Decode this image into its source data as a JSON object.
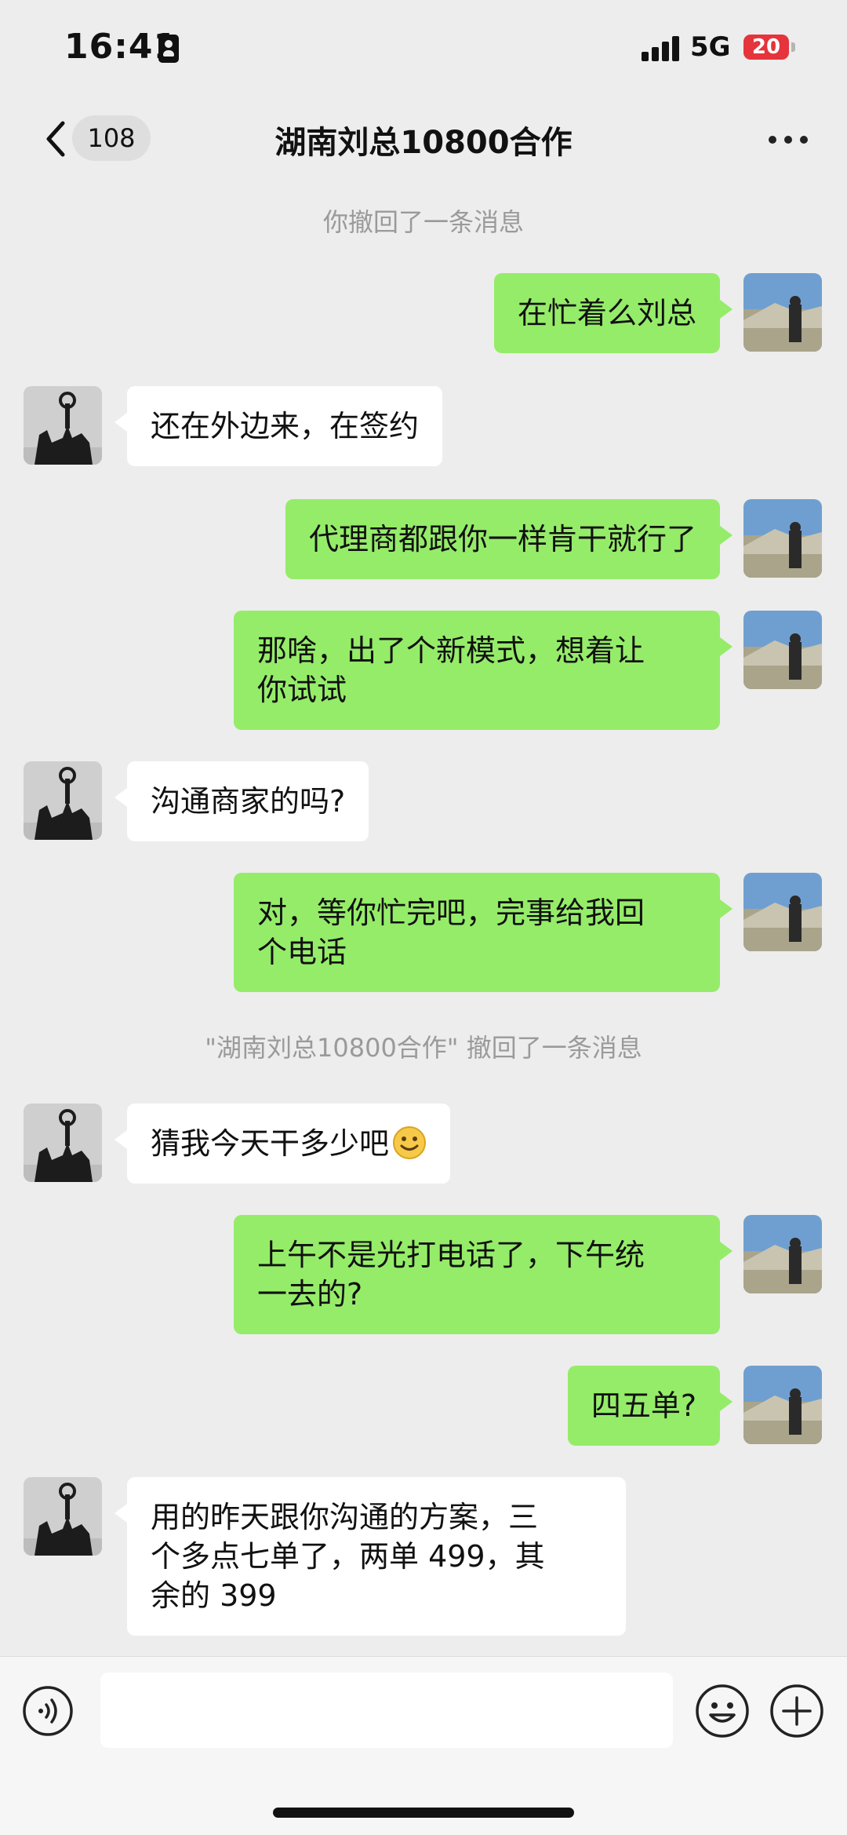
{
  "status_bar": {
    "time": "16:41",
    "network": "5G",
    "battery": "20"
  },
  "nav": {
    "unread_count": "108",
    "title": "湖南刘总10800合作"
  },
  "messages": [
    {
      "type": "system",
      "text": "你撤回了一条消息"
    },
    {
      "type": "out",
      "text": "在忙着么刘总"
    },
    {
      "type": "in",
      "text": "还在外边来，在签约"
    },
    {
      "type": "out",
      "text": "代理商都跟你一样肯干就行了"
    },
    {
      "type": "out",
      "text": "那啥，出了个新模式，想着让\n你试试"
    },
    {
      "type": "in",
      "text": "沟通商家的吗?"
    },
    {
      "type": "out",
      "text": "对，等你忙完吧，完事给我回\n个电话"
    },
    {
      "type": "system",
      "text": "\"湖南刘总10800合作\" 撤回了一条消息"
    },
    {
      "type": "in",
      "text": "猜我今天干多少吧",
      "emoji": "smile-emoji"
    },
    {
      "type": "out",
      "text": "上午不是光打电话了，下午统\n一去的?"
    },
    {
      "type": "out",
      "text": "四五单?"
    },
    {
      "type": "in",
      "text": "用的昨天跟你沟通的方案，三\n个多点七单了，两单 499，其\n余的 399"
    }
  ],
  "input": {
    "value": ""
  },
  "colors": {
    "background": "#ededed",
    "outgoing_bubble": "#95ec69",
    "incoming_bubble": "#ffffff",
    "system_text": "#9a9a9a",
    "battery": "#e5343b"
  },
  "icons": [
    "back-chevron-icon",
    "more-icon",
    "voice-icon",
    "emoji-icon",
    "plus-icon"
  ]
}
